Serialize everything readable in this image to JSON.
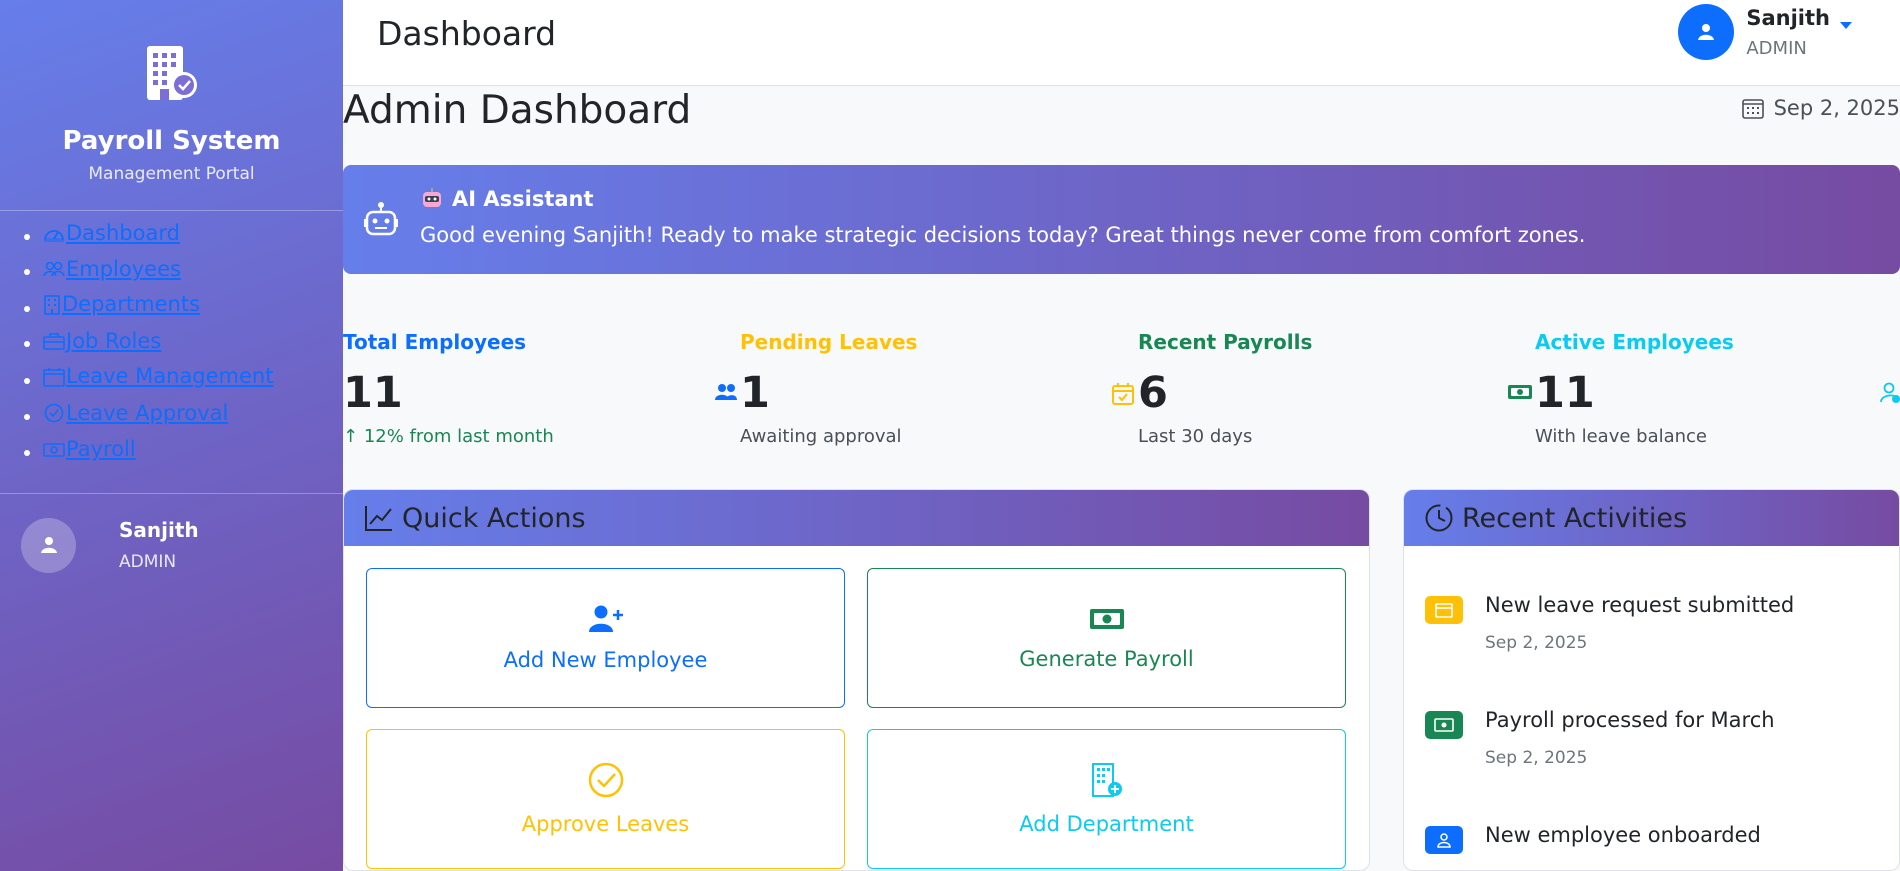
{
  "sidebar": {
    "brand_title": "Payroll System",
    "brand_subtitle": "Management Portal",
    "nav": [
      {
        "label": "Dashboard",
        "icon": "speedometer-icon"
      },
      {
        "label": "Employees",
        "icon": "people-icon"
      },
      {
        "label": "Departments",
        "icon": "building-icon"
      },
      {
        "label": "Job Roles",
        "icon": "briefcase-icon"
      },
      {
        "label": "Leave Management",
        "icon": "calendar-icon"
      },
      {
        "label": "Leave Approval",
        "icon": "check-circle-icon"
      },
      {
        "label": "Payroll",
        "icon": "cash-icon"
      }
    ],
    "user": {
      "name": "Sanjith",
      "role": "ADMIN"
    }
  },
  "topbar": {
    "title": "Dashboard",
    "user": {
      "name": "Sanjith",
      "role": "ADMIN"
    }
  },
  "main": {
    "page_title": "Admin Dashboard",
    "date": "Sep 2, 2025",
    "ai": {
      "title": "AI Assistant",
      "message": "Good evening Sanjith! Ready to make strategic decisions today? Great things never come from comfort zones."
    },
    "stats": [
      {
        "label": "Total Employees",
        "value": "11",
        "foot": "12% from last month",
        "color": "#0d6efd",
        "icon": "people-icon"
      },
      {
        "label": "Pending Leaves",
        "value": "1",
        "foot": "Awaiting approval",
        "color": "#ffc107",
        "icon": "calendar-check-icon"
      },
      {
        "label": "Recent Payrolls",
        "value": "6",
        "foot": "Last 30 days",
        "color": "#198754",
        "icon": "cash-icon"
      },
      {
        "label": "Active Employees",
        "value": "11",
        "foot": "With leave balance",
        "color": "#0dcaf0",
        "icon": "person-check-icon"
      }
    ],
    "quick_actions": {
      "title": "Quick Actions",
      "buttons": [
        {
          "label": "Add New Employee",
          "color": "#0d6efd"
        },
        {
          "label": "Generate Payroll",
          "color": "#198754"
        },
        {
          "label": "Approve Leaves",
          "color": "#ffc107"
        },
        {
          "label": "Add Department",
          "color": "#0dcaf0"
        }
      ]
    },
    "recent": {
      "title": "Recent Activities",
      "items": [
        {
          "title": "New leave request submitted",
          "date": "Sep 2, 2025",
          "color": "#ffc107"
        },
        {
          "title": "Payroll processed for March",
          "date": "Sep 2, 2025",
          "color": "#198754"
        },
        {
          "title": "New employee onboarded",
          "date": "",
          "color": "#0d6efd"
        }
      ]
    }
  }
}
